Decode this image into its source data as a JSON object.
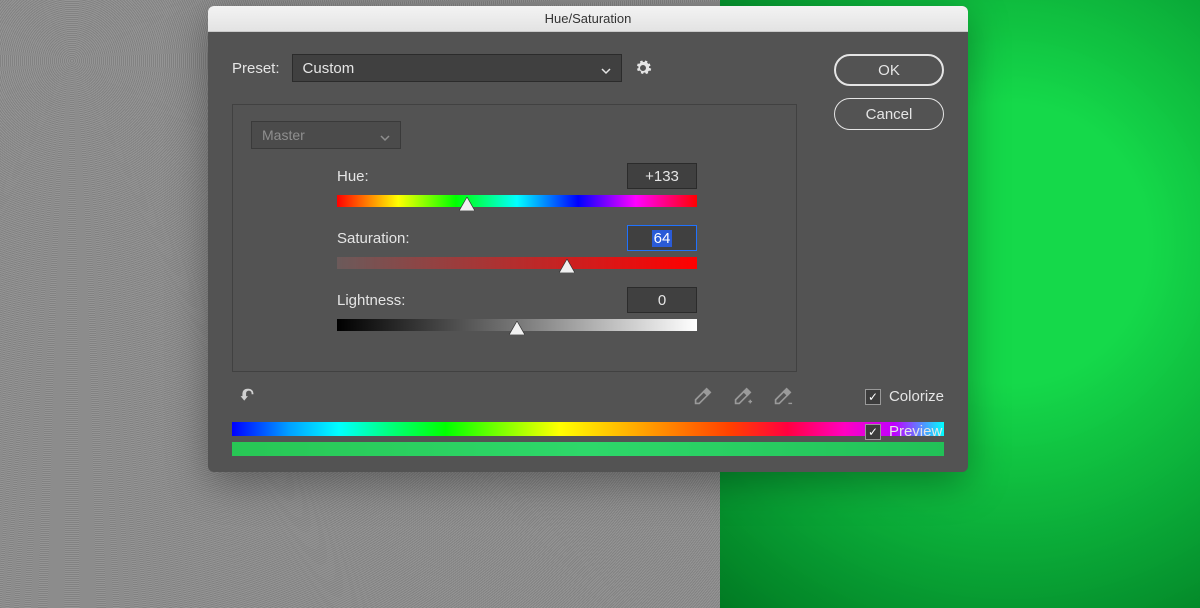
{
  "dialog": {
    "title": "Hue/Saturation",
    "preset_label": "Preset:",
    "preset_value": "Custom",
    "channel_value": "Master",
    "ok_label": "OK",
    "cancel_label": "Cancel",
    "colorize_label": "Colorize",
    "preview_label": "Preview",
    "colorize_checked": true,
    "preview_checked": true
  },
  "sliders": {
    "hue": {
      "label": "Hue:",
      "value": "+133",
      "percent": 36
    },
    "saturation": {
      "label": "Saturation:",
      "value": "64",
      "percent": 64,
      "selected": true
    },
    "lightness": {
      "label": "Lightness:",
      "value": "0",
      "percent": 50
    }
  }
}
